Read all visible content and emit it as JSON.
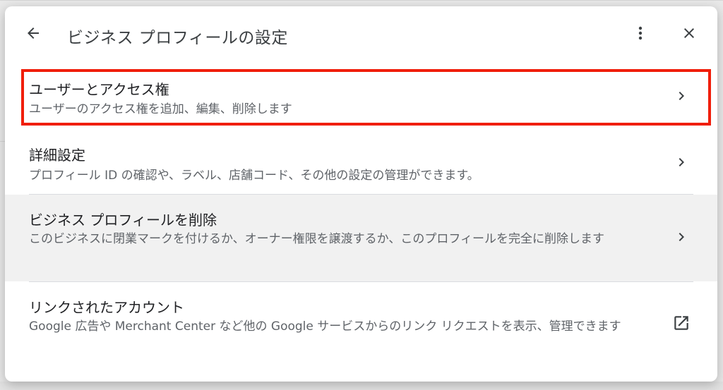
{
  "header": {
    "title": "ビジネス プロフィールの設定",
    "back_icon": "arrow-back-icon",
    "more_icon": "more-vert-icon",
    "close_icon": "close-icon"
  },
  "items": [
    {
      "label": "ユーザーとアクセス権",
      "description": "ユーザーのアクセス権を追加、編集、削除します",
      "icon": "chevron-right-icon",
      "highlighted": true
    },
    {
      "label": "詳細設定",
      "description": "プロフィール ID の確認や、ラベル、店舗コード、その他の設定の管理ができます。",
      "icon": "chevron-right-icon"
    },
    {
      "label": "ビジネス プロフィールを削除",
      "description": "このビジネスに閉業マークを付けるか、オーナー権限を譲渡するか、このプロフィールを完全に削除します",
      "icon": "chevron-right-icon"
    },
    {
      "label": "リンクされたアカウント",
      "description": "Google 広告や Merchant Center など他の Google サービスからのリンク リクエストを表示、管理できます",
      "icon": "open-in-new-icon"
    }
  ],
  "colors": {
    "highlight": "#f01e0a",
    "title_text": "#3c4043",
    "body_text": "#202124",
    "secondary_text": "#5f6368",
    "hover_row": "#f1f1f1"
  }
}
